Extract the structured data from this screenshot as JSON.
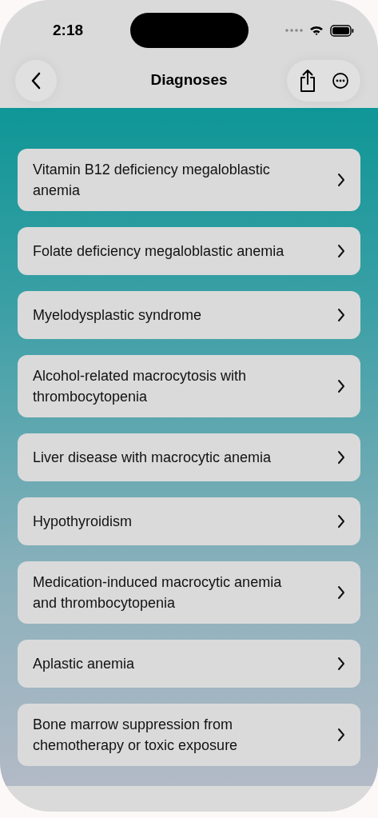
{
  "status_bar": {
    "time": "2:18"
  },
  "nav": {
    "title": "Diagnoses"
  },
  "diagnoses": [
    {
      "label": "Vitamin B12 deficiency megaloblastic anemia"
    },
    {
      "label": "Folate deficiency megaloblastic anemia"
    },
    {
      "label": "Myelodysplastic syndrome"
    },
    {
      "label": "Alcohol-related macrocytosis with thrombocytopenia"
    },
    {
      "label": "Liver disease with macrocytic anemia"
    },
    {
      "label": "Hypothyroidism"
    },
    {
      "label": "Medication-induced macrocytic anemia and thrombocytopenia"
    },
    {
      "label": "Aplastic anemia"
    },
    {
      "label": "Bone marrow suppression from chemotherapy or toxic exposure"
    }
  ]
}
